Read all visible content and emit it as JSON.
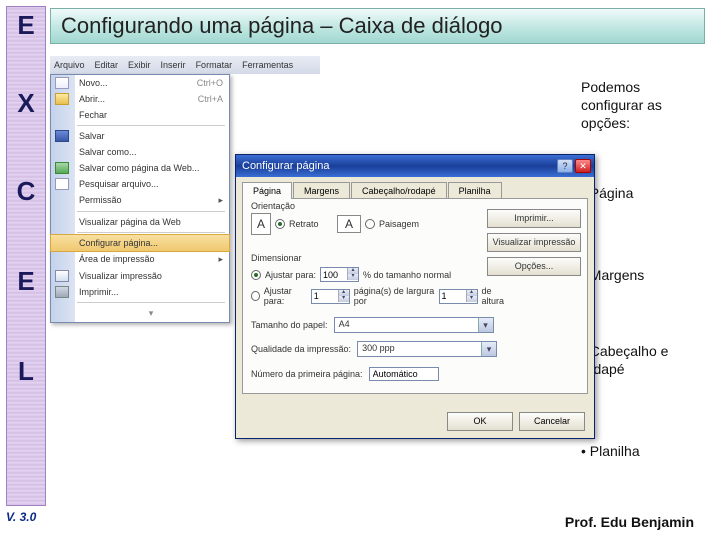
{
  "slide": {
    "title": "Configurando uma página – Caixa de diálogo",
    "letters": [
      "E",
      "X",
      "C",
      "E",
      "L"
    ],
    "version": "V. 3.0",
    "author": "Prof. Edu Benjamin"
  },
  "side": {
    "intro": "Podemos configurar as opções:",
    "b1": "• Página",
    "b2": "• Margens",
    "b3": "• Cabeçalho e rodapé",
    "b4": "• Planilha"
  },
  "menu": {
    "items": [
      "Arquivo",
      "Editar",
      "Exibir",
      "Inserir",
      "Formatar",
      "Ferramentas"
    ]
  },
  "dropdown": {
    "novo": "Novo...",
    "novo_sc": "Ctrl+O",
    "abrir": "Abrir...",
    "abrir_sc": "Ctrl+A",
    "fechar": "Fechar",
    "salvar": "Salvar",
    "salvarcomo": "Salvar como...",
    "salvarweb": "Salvar como página da Web...",
    "pesquisar": "Pesquisar arquivo...",
    "permissao": "Permissão",
    "visualizarweb": "Visualizar página da Web",
    "configurar": "Configurar página...",
    "areaimp": "Área de impressão",
    "visualizarimp": "Visualizar impressão",
    "imprimir": "Imprimir..."
  },
  "dialog": {
    "title": "Configurar página",
    "tabs": {
      "pagina": "Página",
      "margens": "Margens",
      "cabecalho": "Cabeçalho/rodapé",
      "planilha": "Planilha"
    },
    "orient_label": "Orientação",
    "retrato": "Retrato",
    "paisagem": "Paisagem",
    "dim_label": "Dimensionar",
    "ajustar_para": "Ajustar para:",
    "ajustar_val": "100",
    "ajustar_suf": "% do tamanho normal",
    "ajustar_para2": "Ajustar para:",
    "larg_val": "1",
    "larg_suf": "página(s) de largura por",
    "alt_val": "1",
    "alt_suf": "de altura",
    "tamanho_label": "Tamanho do papel:",
    "tamanho_val": "A4",
    "qualidade_label": "Qualidade da impressão:",
    "qualidade_val": "300 ppp",
    "primeira_label": "Número da primeira página:",
    "primeira_val": "Automático",
    "btn_imprimir": "Imprimir...",
    "btn_visualizar": "Visualizar impressão",
    "btn_opcoes": "Opções...",
    "ok": "OK",
    "cancel": "Cancelar"
  }
}
